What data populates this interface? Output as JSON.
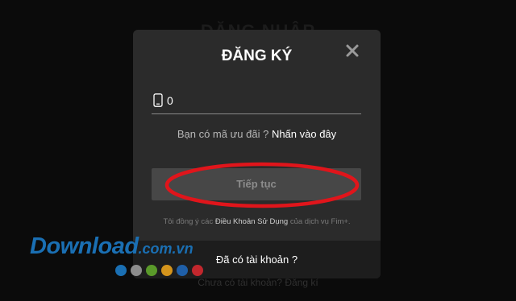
{
  "background": {
    "title": "ĐĂNG NHẬP",
    "footer_text": "Chưa có tài khoản? Đăng kí"
  },
  "modal": {
    "title": "ĐĂNG KÝ",
    "close_icon": "close-icon",
    "phone": {
      "icon": "mobile-phone-icon",
      "value": "0"
    },
    "promo": {
      "text": "Bạn có mã ưu đãi ? ",
      "link": "Nhấn vào đây"
    },
    "continue_label": "Tiếp tục",
    "terms": {
      "prefix": "Tôi đồng ý các ",
      "link": "Điều Khoản Sử Dụng",
      "suffix": " của dịch vụ Fim+."
    },
    "footer_label": "Đã có tài khoản ?"
  },
  "annotation": {
    "color": "#e0151b"
  },
  "watermark": {
    "main": "Download",
    "sub": ".com.vn",
    "dot_colors": [
      "#1a6fb3",
      "#8d8d8d",
      "#5a9a2a",
      "#d4941c",
      "#1f5fa8",
      "#c2272d"
    ]
  }
}
